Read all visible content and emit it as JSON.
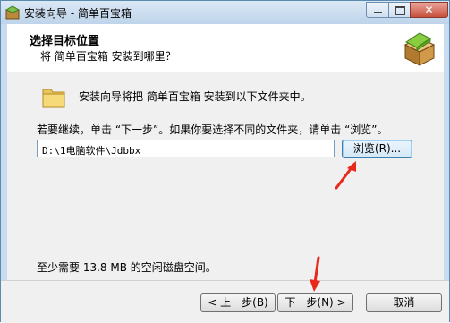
{
  "window": {
    "title": "安装向导 - 简单百宝箱"
  },
  "header": {
    "title": "选择目标位置",
    "subtitle": "将 简单百宝箱 安装到哪里？"
  },
  "body": {
    "intro": "安装向导将把 简单百宝箱 安装到以下文件夹中。",
    "instruction": "若要继续，单击 “下一步”。如果你要选择不同的文件夹，请单击 “浏览”。",
    "path_value": "D:\\1电脑软件\\Jdbbx",
    "browse_label": "浏览(R)...",
    "space_text": "至少需要 13.8 MB 的空闲磁盘空间。"
  },
  "footer": {
    "back_label": "< 上一步(B)",
    "next_label": "下一步(N) >",
    "cancel_label": "取消"
  },
  "colors": {
    "annotation_arrow": "#e8291c",
    "accent_button": "#3c7fb1"
  }
}
